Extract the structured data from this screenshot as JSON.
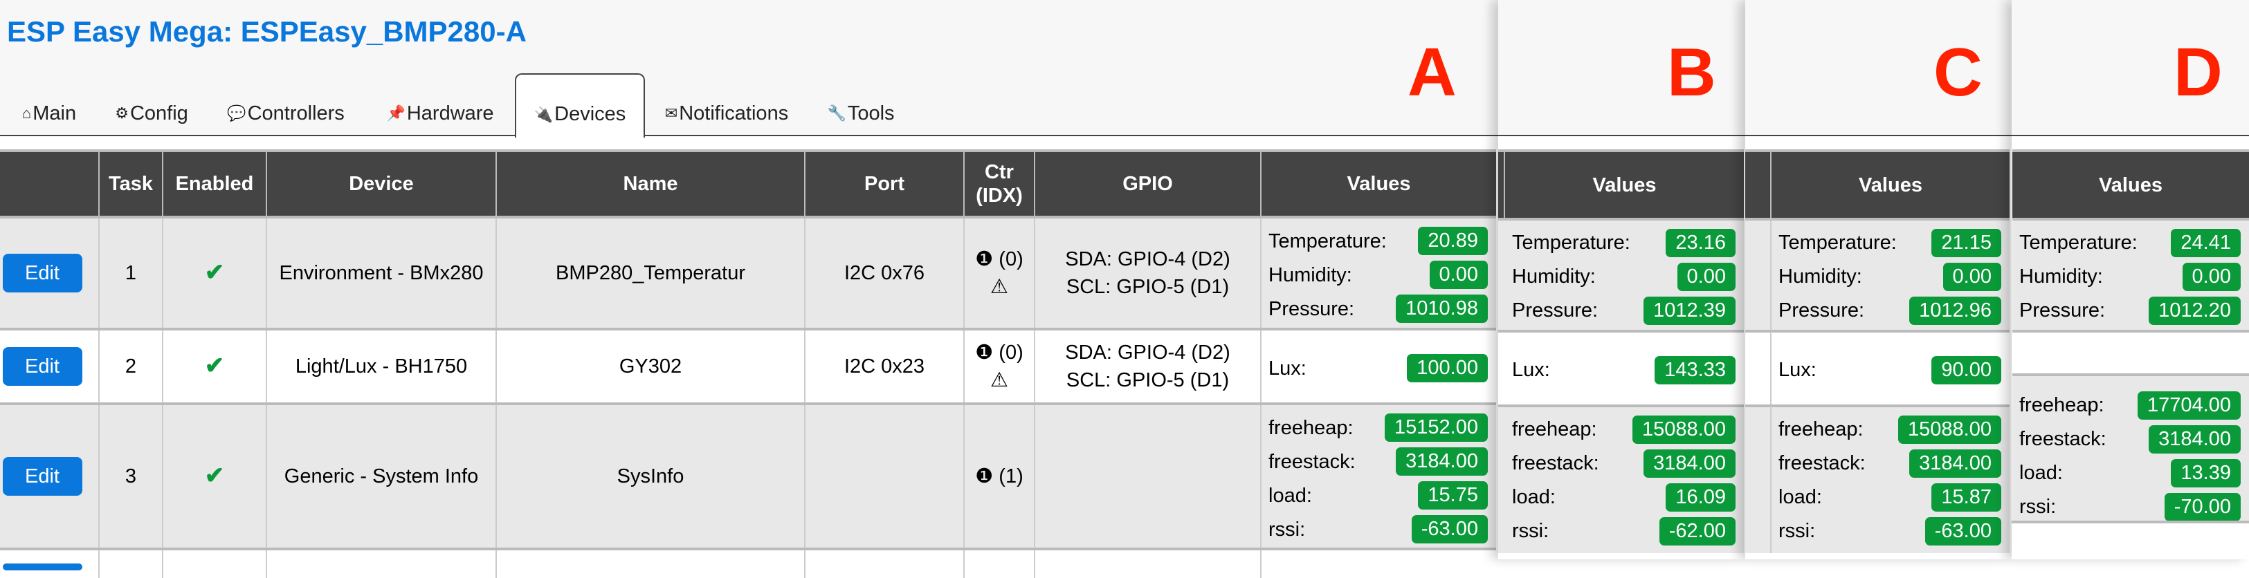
{
  "title": "ESP Easy Mega: ESPEasy_BMP280-A",
  "tabs": [
    {
      "icon": "⌂",
      "label": "Main"
    },
    {
      "icon": "⚙",
      "label": "Config"
    },
    {
      "icon": "💬",
      "label": "Controllers"
    },
    {
      "icon": "📌",
      "label": "Hardware"
    },
    {
      "icon": "🔌",
      "label": "Devices",
      "active": true
    },
    {
      "icon": "✉",
      "label": "Notifications"
    },
    {
      "icon": "🔧",
      "label": "Tools"
    }
  ],
  "headers": [
    "",
    "Task",
    "Enabled",
    "Device",
    "Name",
    "Port",
    "Ctr (IDX)",
    "GPIO",
    "Values"
  ],
  "rows": [
    {
      "edit": "Edit",
      "task": "1",
      "enabled": "✔",
      "device": "Environment - BMx280",
      "name": "BMP280_Temperatur",
      "port": "I2C 0x76",
      "ctr": "❶ (0)",
      "ctr_warn": "⚠",
      "gpio1": "SDA: GPIO-4 (D2)",
      "gpio2": "SCL: GPIO-5 (D1)"
    },
    {
      "edit": "Edit",
      "task": "2",
      "enabled": "✔",
      "device": "Light/Lux - BH1750",
      "name": "GY302",
      "port": "I2C 0x23",
      "ctr": "❶ (0)",
      "ctr_warn": "⚠",
      "gpio1": "SDA: GPIO-4 (D2)",
      "gpio2": "SCL: GPIO-5 (D1)"
    },
    {
      "edit": "Edit",
      "task": "3",
      "enabled": "✔",
      "device": "Generic - System Info",
      "name": "SysInfo",
      "port": "",
      "ctr": "❶ (1)",
      "ctr_warn": "",
      "gpio1": "",
      "gpio2": ""
    }
  ],
  "panels": [
    {
      "letter": "A",
      "header": "Values",
      "rows": [
        [
          {
            "label": "Temperature:",
            "value": "20.89"
          },
          {
            "label": "Humidity:",
            "value": "0.00"
          },
          {
            "label": "Pressure:",
            "value": "1010.98"
          }
        ],
        [
          {
            "label": "Lux:",
            "value": "100.00"
          }
        ],
        [
          {
            "label": "freeheap:",
            "value": "15152.00"
          },
          {
            "label": "freestack:",
            "value": "3184.00"
          },
          {
            "label": "load:",
            "value": "15.75"
          },
          {
            "label": "rssi:",
            "value": "-63.00"
          }
        ]
      ]
    },
    {
      "letter": "B",
      "header": "Values",
      "rows": [
        [
          {
            "label": "Temperature:",
            "value": "23.16"
          },
          {
            "label": "Humidity:",
            "value": "0.00"
          },
          {
            "label": "Pressure:",
            "value": "1012.39"
          }
        ],
        [
          {
            "label": "Lux:",
            "value": "143.33"
          }
        ],
        [
          {
            "label": "freeheap:",
            "value": "15088.00"
          },
          {
            "label": "freestack:",
            "value": "3184.00"
          },
          {
            "label": "load:",
            "value": "16.09"
          },
          {
            "label": "rssi:",
            "value": "-62.00"
          }
        ]
      ]
    },
    {
      "letter": "C",
      "header": "Values",
      "rows": [
        [
          {
            "label": "Temperature:",
            "value": "21.15"
          },
          {
            "label": "Humidity:",
            "value": "0.00"
          },
          {
            "label": "Pressure:",
            "value": "1012.96"
          }
        ],
        [
          {
            "label": "Lux:",
            "value": "90.00"
          }
        ],
        [
          {
            "label": "freeheap:",
            "value": "15088.00"
          },
          {
            "label": "freestack:",
            "value": "3184.00"
          },
          {
            "label": "load:",
            "value": "15.87"
          },
          {
            "label": "rssi:",
            "value": "-63.00"
          }
        ]
      ]
    },
    {
      "letter": "D",
      "header": "Values",
      "rows": [
        [
          {
            "label": "Temperature:",
            "value": "24.41"
          },
          {
            "label": "Humidity:",
            "value": "0.00"
          },
          {
            "label": "Pressure:",
            "value": "1012.20"
          }
        ],
        [],
        [
          {
            "label": "freeheap:",
            "value": "17704.00"
          },
          {
            "label": "freestack:",
            "value": "3184.00"
          },
          {
            "label": "load:",
            "value": "13.39"
          },
          {
            "label": "rssi:",
            "value": "-70.00"
          }
        ]
      ]
    }
  ],
  "colors": {
    "title": "#0a77dc",
    "edit_button": "#0a77dc",
    "value_badge": "#0a9a3a",
    "check": "#0a9a3a",
    "letter": "#ff2200",
    "header_bg": "#444444"
  }
}
